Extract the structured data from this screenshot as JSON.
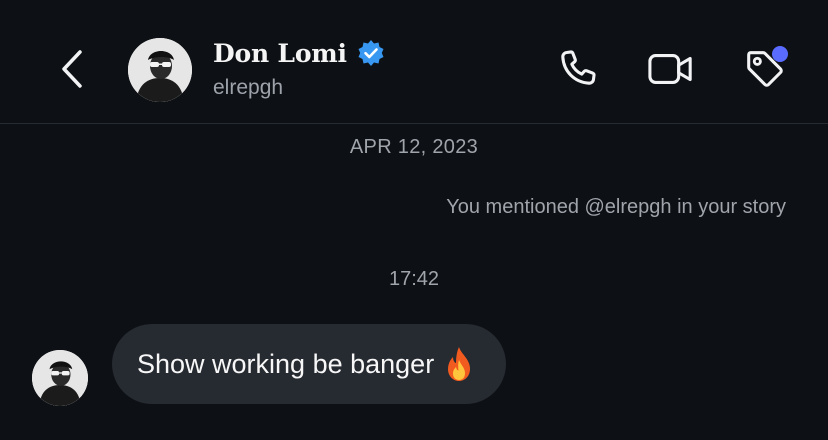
{
  "header": {
    "name": "Don Lomi",
    "username": "elrepgh",
    "verified": true,
    "icons": [
      "back-icon",
      "phone-icon",
      "video-camera-icon",
      "tag-icon"
    ],
    "has_notification_dot": true,
    "accent_color": "#5a6cff",
    "verified_color": "#3897f0"
  },
  "thread": {
    "date_separator": "APR 12, 2023",
    "mention_note": "You mentioned @elrepgh in your story",
    "time_separator": "17:42",
    "messages": [
      {
        "sender": "Don Lomi",
        "text": "Show working be banger",
        "emoji": "fire-emoji"
      }
    ]
  }
}
